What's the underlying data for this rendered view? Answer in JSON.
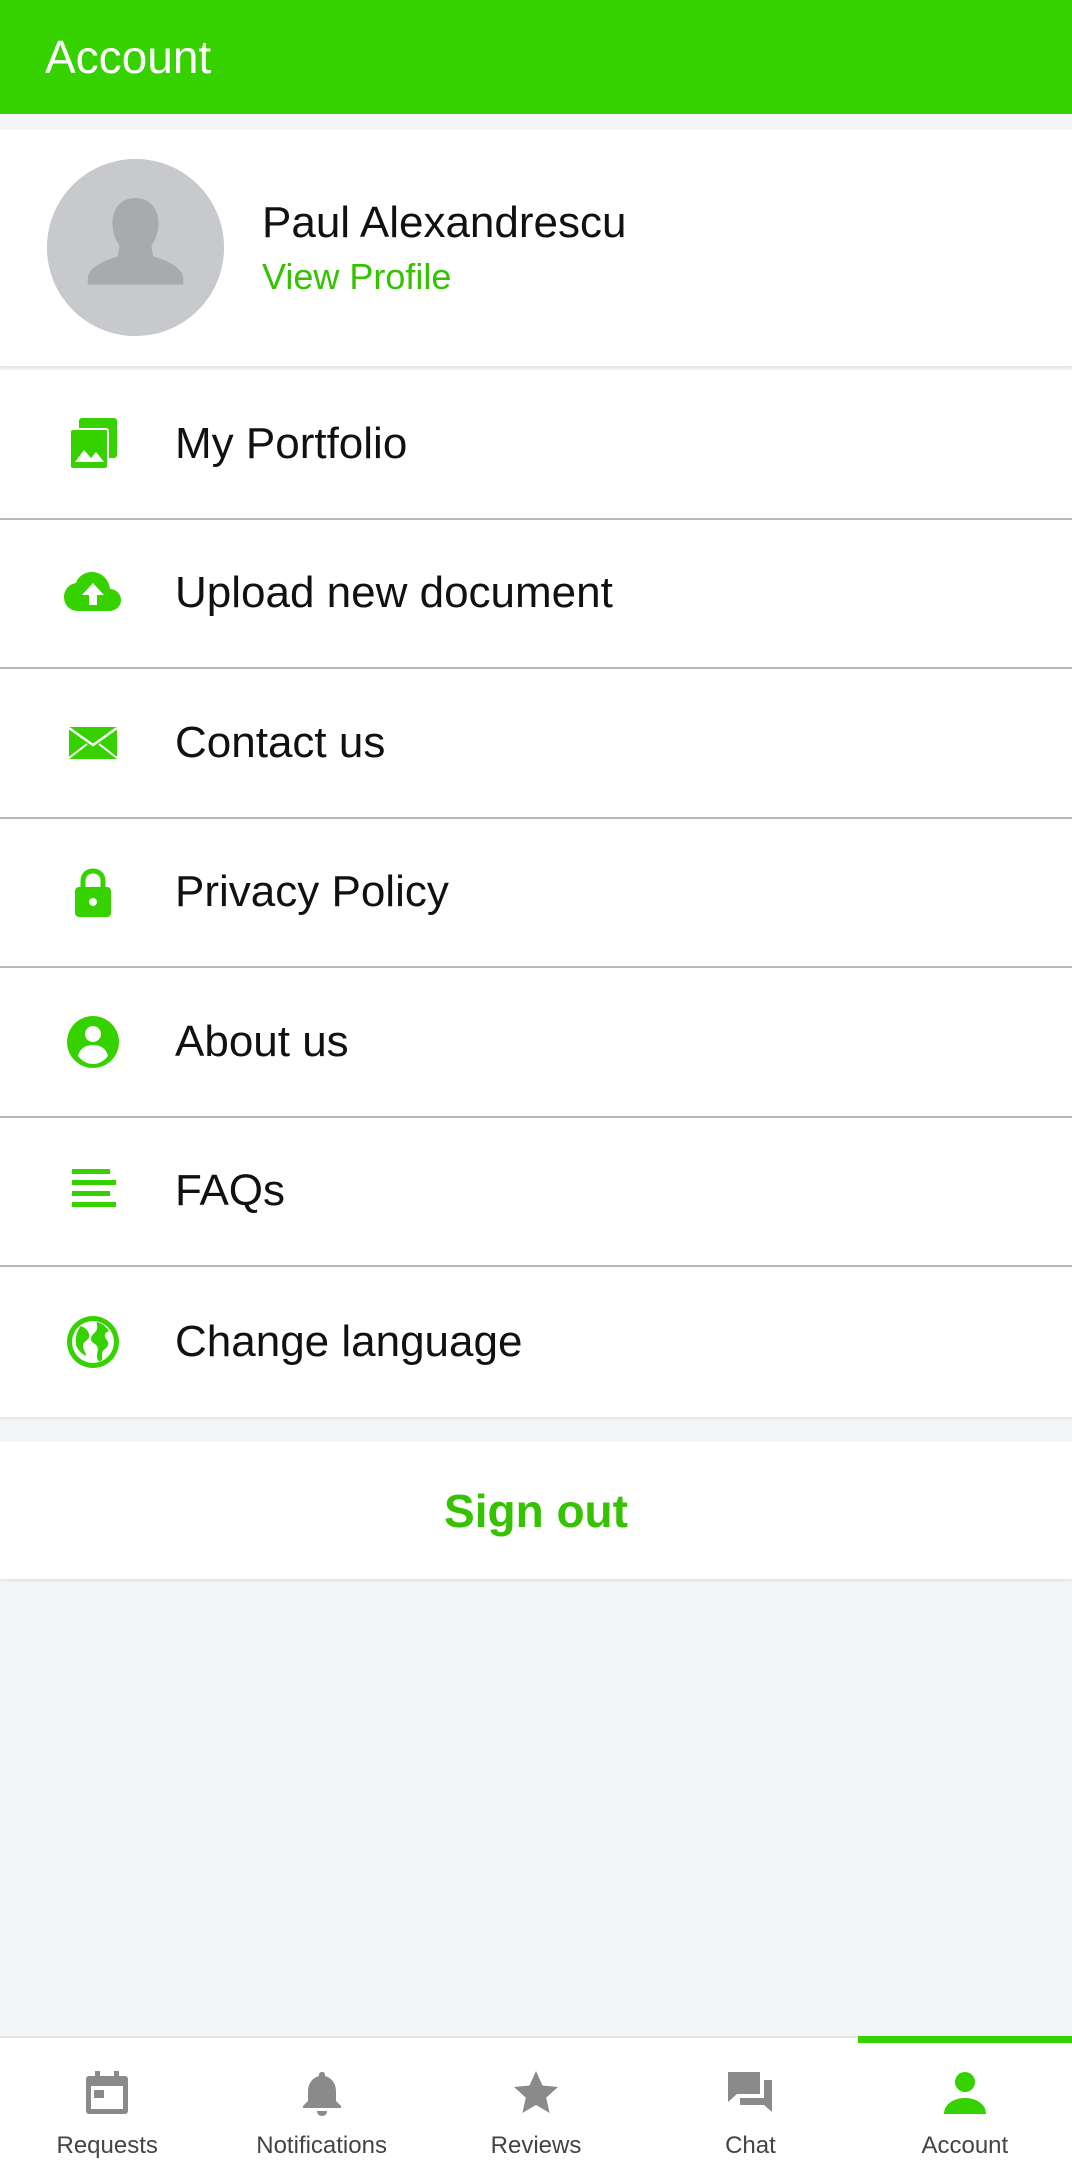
{
  "app_bar": {
    "title": "Account"
  },
  "profile": {
    "name": "Paul Alexandrescu",
    "link": "View Profile"
  },
  "menu": [
    {
      "label": "My Portfolio",
      "icon": "image-gallery-icon"
    },
    {
      "label": "Upload new document",
      "icon": "cloud-upload-icon"
    },
    {
      "label": "Contact us",
      "icon": "envelope-icon"
    },
    {
      "label": "Privacy Policy",
      "icon": "lock-icon"
    },
    {
      "label": "About us",
      "icon": "person-circle-icon"
    },
    {
      "label": "FAQs",
      "icon": "lines-icon"
    },
    {
      "label": "Change language",
      "icon": "globe-icon"
    }
  ],
  "sign_out": {
    "label": "Sign out"
  },
  "bottom_nav": [
    {
      "label": "Requests",
      "icon": "calendar-icon",
      "active": false
    },
    {
      "label": "Notifications",
      "icon": "bell-icon",
      "active": false
    },
    {
      "label": "Reviews",
      "icon": "star-icon",
      "active": false
    },
    {
      "label": "Chat",
      "icon": "chat-bubbles-icon",
      "active": false
    },
    {
      "label": "Account",
      "icon": "person-icon",
      "active": true
    }
  ],
  "colors": {
    "brand_green": "#35d200",
    "link_green": "#35c200",
    "nav_inactive": "#8a8a8a",
    "background": "#f4f5f7"
  }
}
